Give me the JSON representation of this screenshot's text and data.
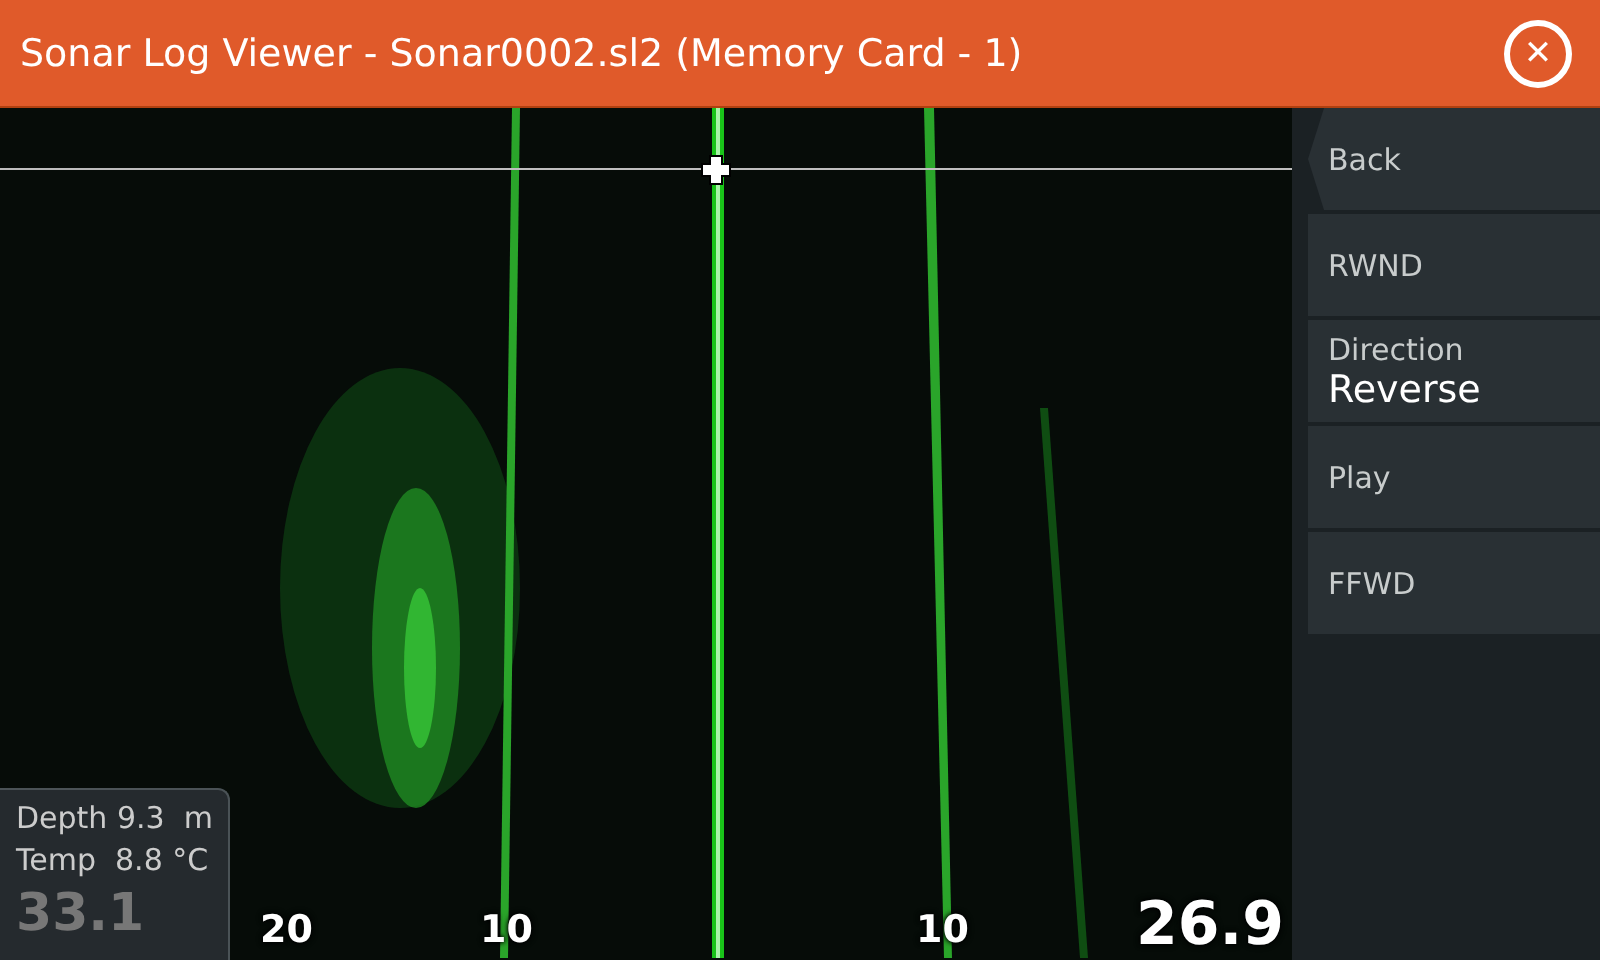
{
  "window": {
    "title": "Sonar Log Viewer - Sonar0002.sl2 (Memory Card - 1)",
    "close": "✕"
  },
  "menu": [
    {
      "kind": "button",
      "label": "Back"
    },
    {
      "kind": "button",
      "label": "RWND"
    },
    {
      "kind": "option",
      "label": "Direction",
      "value": "Reverse"
    },
    {
      "kind": "button",
      "label": "Play"
    },
    {
      "kind": "button",
      "label": "FFWD"
    }
  ],
  "readout": {
    "large_value": "33.1",
    "lines": [
      "Depth 9.3  m",
      "Temp  8.8 °C"
    ]
  },
  "scale_labels": [
    {
      "text": "20"
    },
    {
      "text": "10"
    },
    {
      "text": "10"
    },
    {
      "text": "26.9",
      "kind": "large"
    }
  ]
}
